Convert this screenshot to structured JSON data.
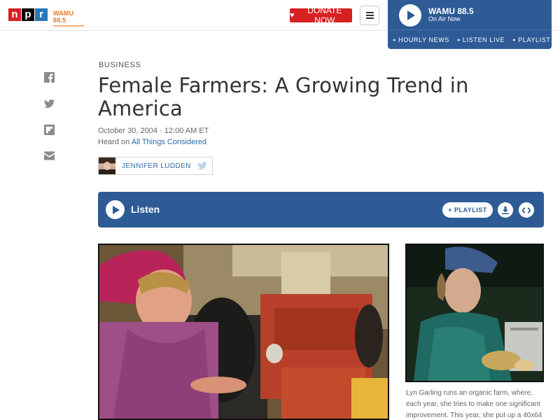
{
  "header": {
    "logo": {
      "n": "n",
      "p": "p",
      "r": "r"
    },
    "station_logo": "WAMU 88.5",
    "donate_label": "DONATE NOW",
    "menu_icon": "hamburger-icon"
  },
  "player": {
    "station": "WAMU 88.5",
    "status": "On Air Now",
    "links": [
      {
        "label": "HOURLY NEWS"
      },
      {
        "label": "LISTEN LIVE"
      },
      {
        "label": "PLAYLIST"
      }
    ]
  },
  "share_icons": [
    "facebook-icon",
    "twitter-icon",
    "flipboard-icon",
    "email-icon"
  ],
  "article": {
    "section": "BUSINESS",
    "title": "Female Farmers: A Growing Trend in America",
    "date": "October 30, 2004 · 12:00 AM ET",
    "heard_on_prefix": "Heard on",
    "heard_on_program": "All Things Considered",
    "author": "JENNIFER LUDDEN"
  },
  "audio": {
    "listen_label": "Listen",
    "playlist_label": "PLAYLIST",
    "download_icon": "download-icon",
    "embed_icon": "embed-icon"
  },
  "side_image": {
    "caption": "Lyn Garling runs an organic farm, where, each year, she tries to make one significant improvement. This year, she put up a 40x64"
  },
  "colors": {
    "brand_blue": "#2e5b96",
    "donate_red": "#d62021",
    "link_blue": "#2e6aa8"
  }
}
